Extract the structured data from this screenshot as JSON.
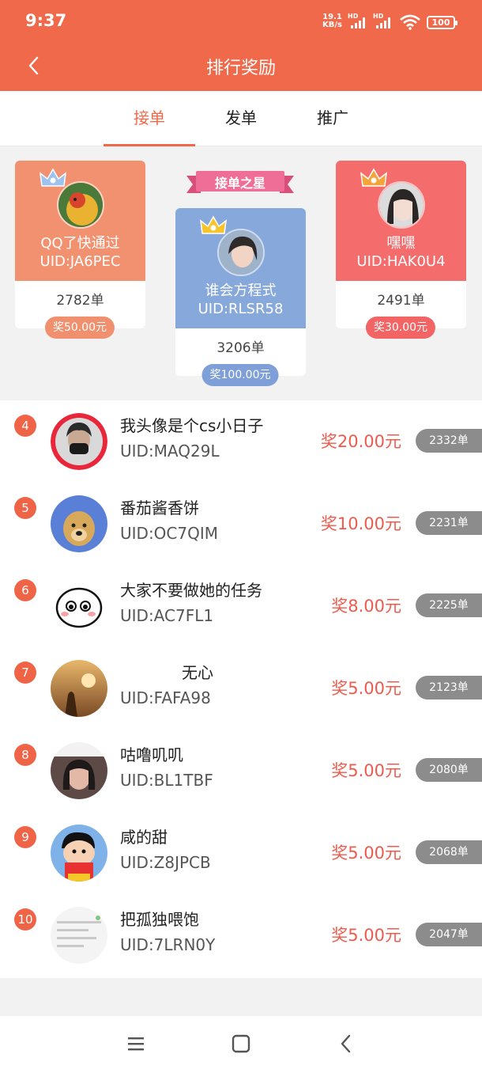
{
  "status_bar": {
    "time": "9:37",
    "net_speed_value": "19.1",
    "net_speed_unit": "KB/s",
    "sim1": "HD",
    "sim2": "HD",
    "battery": "100"
  },
  "header": {
    "title": "排行奖励",
    "back_icon": "chevron-left-icon"
  },
  "tabs": [
    {
      "label": "接单",
      "active": true
    },
    {
      "label": "发单",
      "active": false
    },
    {
      "label": "推广",
      "active": false
    }
  ],
  "star_banner": "接单之星",
  "podium": [
    {
      "position": 2,
      "name": "QQ了快通过",
      "uid": "UID:JA6PEC",
      "count": "2782单",
      "reward": "奖50.00元",
      "color": "#f2916f",
      "pill_color": "#f0906e"
    },
    {
      "position": 1,
      "name": "谁会方程式",
      "uid": "UID:RLSR58",
      "count": "3206单",
      "reward": "奖100.00元",
      "color": "#87a8db",
      "pill_color": "#7e9fd8"
    },
    {
      "position": 3,
      "name": "嘿嘿",
      "uid": "UID:HAK0U4",
      "count": "2491单",
      "reward": "奖30.00元",
      "color": "#f56c6c",
      "pill_color": "#f36565"
    }
  ],
  "ranking": [
    {
      "rank": "4",
      "name": "我头像是个cs小日子",
      "uid": "UID:MAQ29L",
      "reward": "奖20.00元",
      "count": "2332单"
    },
    {
      "rank": "5",
      "name": "番茄酱香饼",
      "uid": "UID:OC7QIM",
      "reward": "奖10.00元",
      "count": "2231单"
    },
    {
      "rank": "6",
      "name": "大家不要做她的任务",
      "uid": "UID:AC7FL1",
      "reward": "奖8.00元",
      "count": "2225单"
    },
    {
      "rank": "7",
      "name": "无心",
      "uid": "UID:FAFA98",
      "reward": "奖5.00元",
      "count": "2123单"
    },
    {
      "rank": "8",
      "name": "咕噜叽叽",
      "uid": "UID:BL1TBF",
      "reward": "奖5.00元",
      "count": "2080单"
    },
    {
      "rank": "9",
      "name": "咸的甜",
      "uid": "UID:Z8JPCB",
      "reward": "奖5.00元",
      "count": "2068单"
    },
    {
      "rank": "10",
      "name": "把孤独喂饱",
      "uid": "UID:7LRN0Y",
      "reward": "奖5.00元",
      "count": "2047单"
    }
  ],
  "colors": {
    "accent": "#f0694a",
    "reward_text": "#ef5a4c",
    "count_badge": "#8c8c8c"
  },
  "system_nav": [
    "menu-icon",
    "home-icon",
    "back-icon"
  ]
}
